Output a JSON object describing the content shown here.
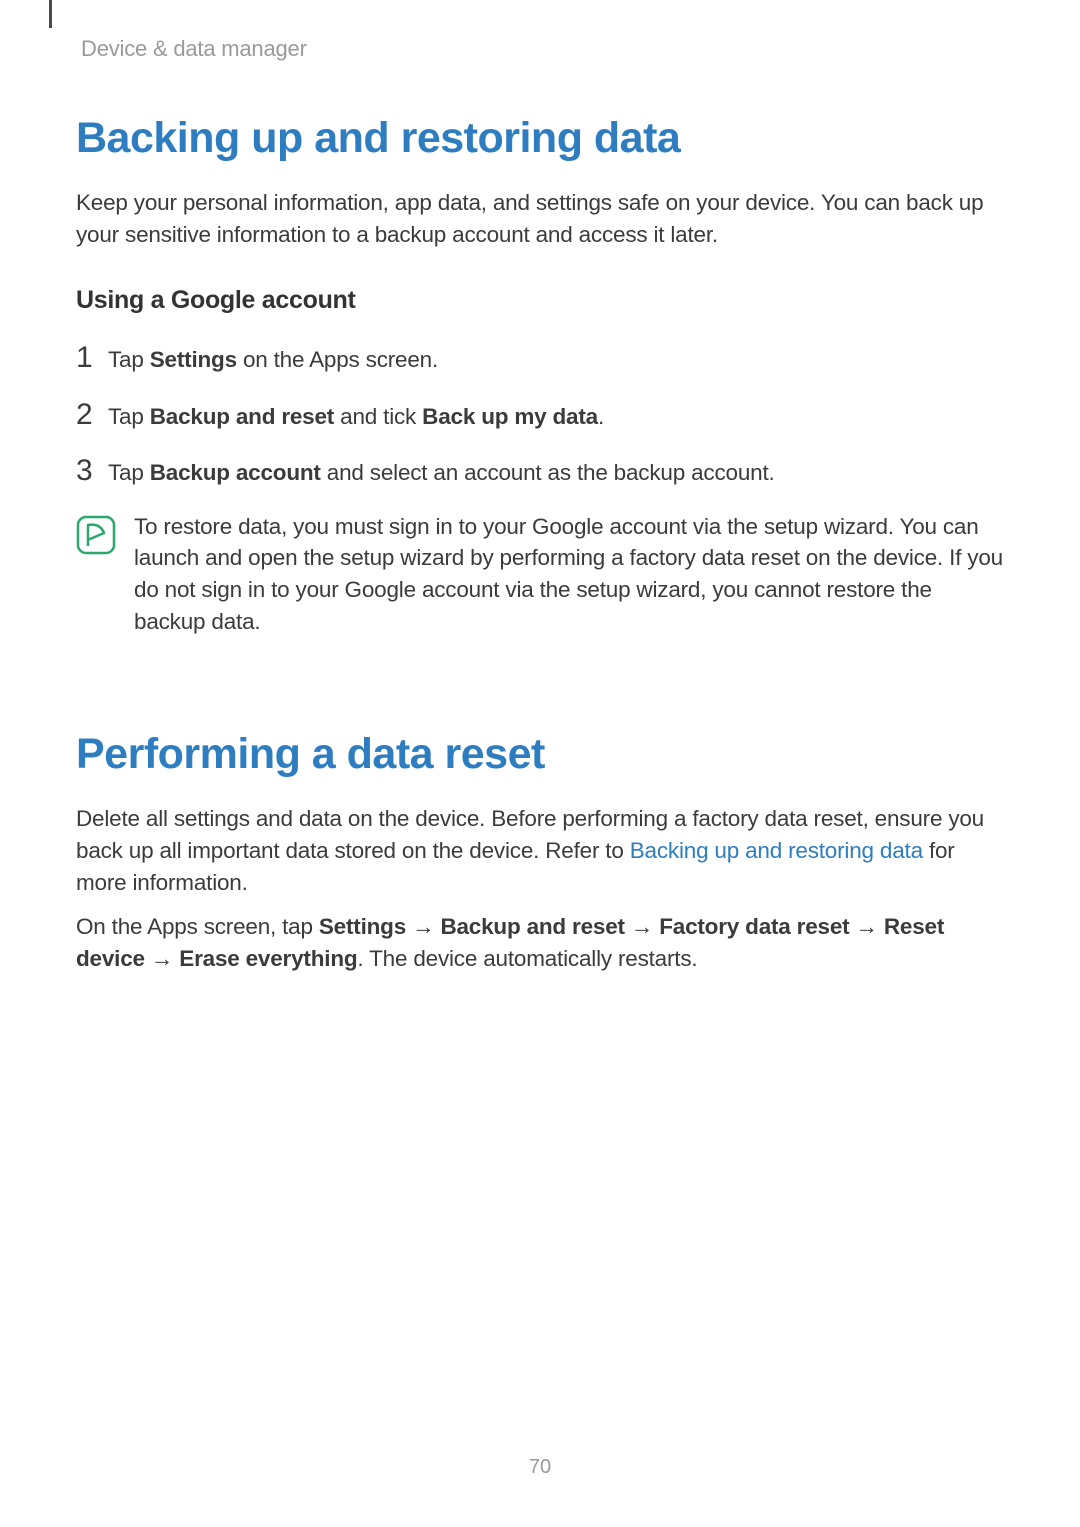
{
  "breadcrumb": "Device & data manager",
  "section1": {
    "title": "Backing up and restoring data",
    "intro": "Keep your personal information, app data, and settings safe on your device. You can back up your sensitive information to a backup account and access it later.",
    "subheading": "Using a Google account",
    "steps": {
      "n1": "1",
      "s1_a": "Tap ",
      "s1_b": "Settings",
      "s1_c": " on the Apps screen.",
      "n2": "2",
      "s2_a": "Tap ",
      "s2_b": "Backup and reset",
      "s2_c": " and tick ",
      "s2_d": "Back up my data",
      "s2_e": ".",
      "n3": "3",
      "s3_a": "Tap ",
      "s3_b": "Backup account",
      "s3_c": " and select an account as the backup account."
    },
    "note": "To restore data, you must sign in to your Google account via the setup wizard. You can launch and open the setup wizard by performing a factory data reset on the device. If you do not sign in to your Google account via the setup wizard, you cannot restore the backup data."
  },
  "section2": {
    "title": "Performing a data reset",
    "para1_a": "Delete all settings and data on the device. Before performing a factory data reset, ensure you back up all important data stored on the device. Refer to ",
    "para1_link": "Backing up and restoring data",
    "para1_b": " for more information.",
    "para2_a": "On the Apps screen, tap ",
    "para2_b": "Settings",
    "para2_arrow": " → ",
    "para2_c": "Backup and reset",
    "para2_d": "Factory data reset",
    "para2_e": "Reset device",
    "para2_f": "Erase everything",
    "para2_g": ". The device automatically restarts."
  },
  "page_number": "70"
}
